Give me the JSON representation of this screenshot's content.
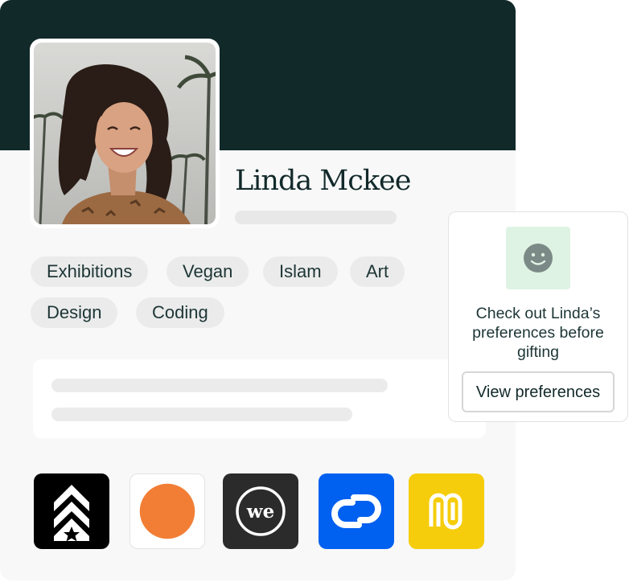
{
  "profile": {
    "name": "Linda Mckee",
    "tags": [
      "Exhibitions",
      "Vegan",
      "Islam",
      "Art",
      "Design",
      "Coding"
    ]
  },
  "brands": [
    {
      "icon": "chevron-star-logo-icon",
      "color": "#000000"
    },
    {
      "icon": "orange-circle-logo-icon",
      "color": "#f27e35"
    },
    {
      "icon": "we-logo-icon",
      "color": "#2b2b2b"
    },
    {
      "icon": "link-logo-icon",
      "color": "#0060f0"
    },
    {
      "icon": "m-logo-icon",
      "color": "#f5cd0c"
    }
  ],
  "preferences_card": {
    "icon": "smile-icon",
    "message": "Check out Linda’s preferences before gifting",
    "button_label": "View preferences"
  },
  "colors": {
    "banner": "#12292a",
    "tag_background": "#ebebeb",
    "accent_green": "#dff3e4"
  }
}
